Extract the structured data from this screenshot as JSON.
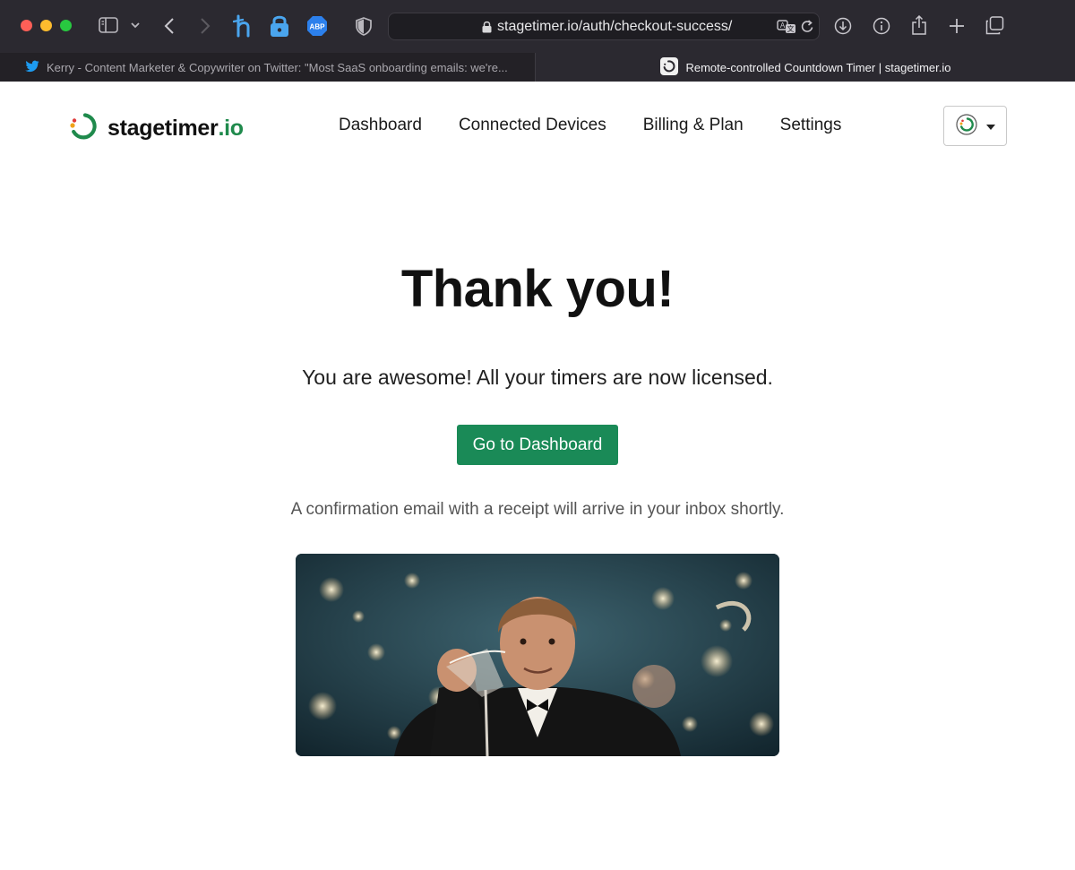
{
  "browser": {
    "url": "stagetimer.io/auth/checkout-success/",
    "tabs": [
      {
        "title": "Kerry - Content Marketer & Copywriter on Twitter: \"Most SaaS onboarding emails: we're...",
        "favicon": "twitter-icon",
        "active": false
      },
      {
        "title": "Remote-controlled Countdown Timer | stagetimer.io",
        "favicon": "stagetimer-icon",
        "active": true
      }
    ],
    "extensions": [
      "honey-icon",
      "password-lock-icon",
      "adblock-plus-icon",
      "privacy-shield-icon"
    ],
    "toolbar_icons": [
      "sidebar-icon",
      "chevron-down-icon",
      "back-icon",
      "forward-icon",
      "translate-icon",
      "reload-icon",
      "download-icon",
      "info-icon",
      "share-icon",
      "new-tab-icon",
      "tab-overview-icon"
    ],
    "extension_badge": "ABP",
    "colors": {
      "chrome": "#2b2930",
      "traffic_red": "#fe5f57",
      "traffic_yellow": "#febc2e",
      "traffic_green": "#28c840"
    }
  },
  "site": {
    "brand_name": "stagetimer",
    "brand_tld": ".io",
    "nav": [
      "Dashboard",
      "Connected Devices",
      "Billing & Plan",
      "Settings"
    ],
    "account_menu_icon": "caret-down-icon",
    "colors": {
      "brand_green": "#1f8a4c",
      "button_green": "#1a8a57"
    }
  },
  "main": {
    "title": "Thank you!",
    "subtitle": "You are awesome! All your timers are now licensed.",
    "cta_label": "Go to Dashboard",
    "note": "A confirmation email with a receipt will arrive in your inbox shortly.",
    "image": "celebration-toast-gif"
  }
}
